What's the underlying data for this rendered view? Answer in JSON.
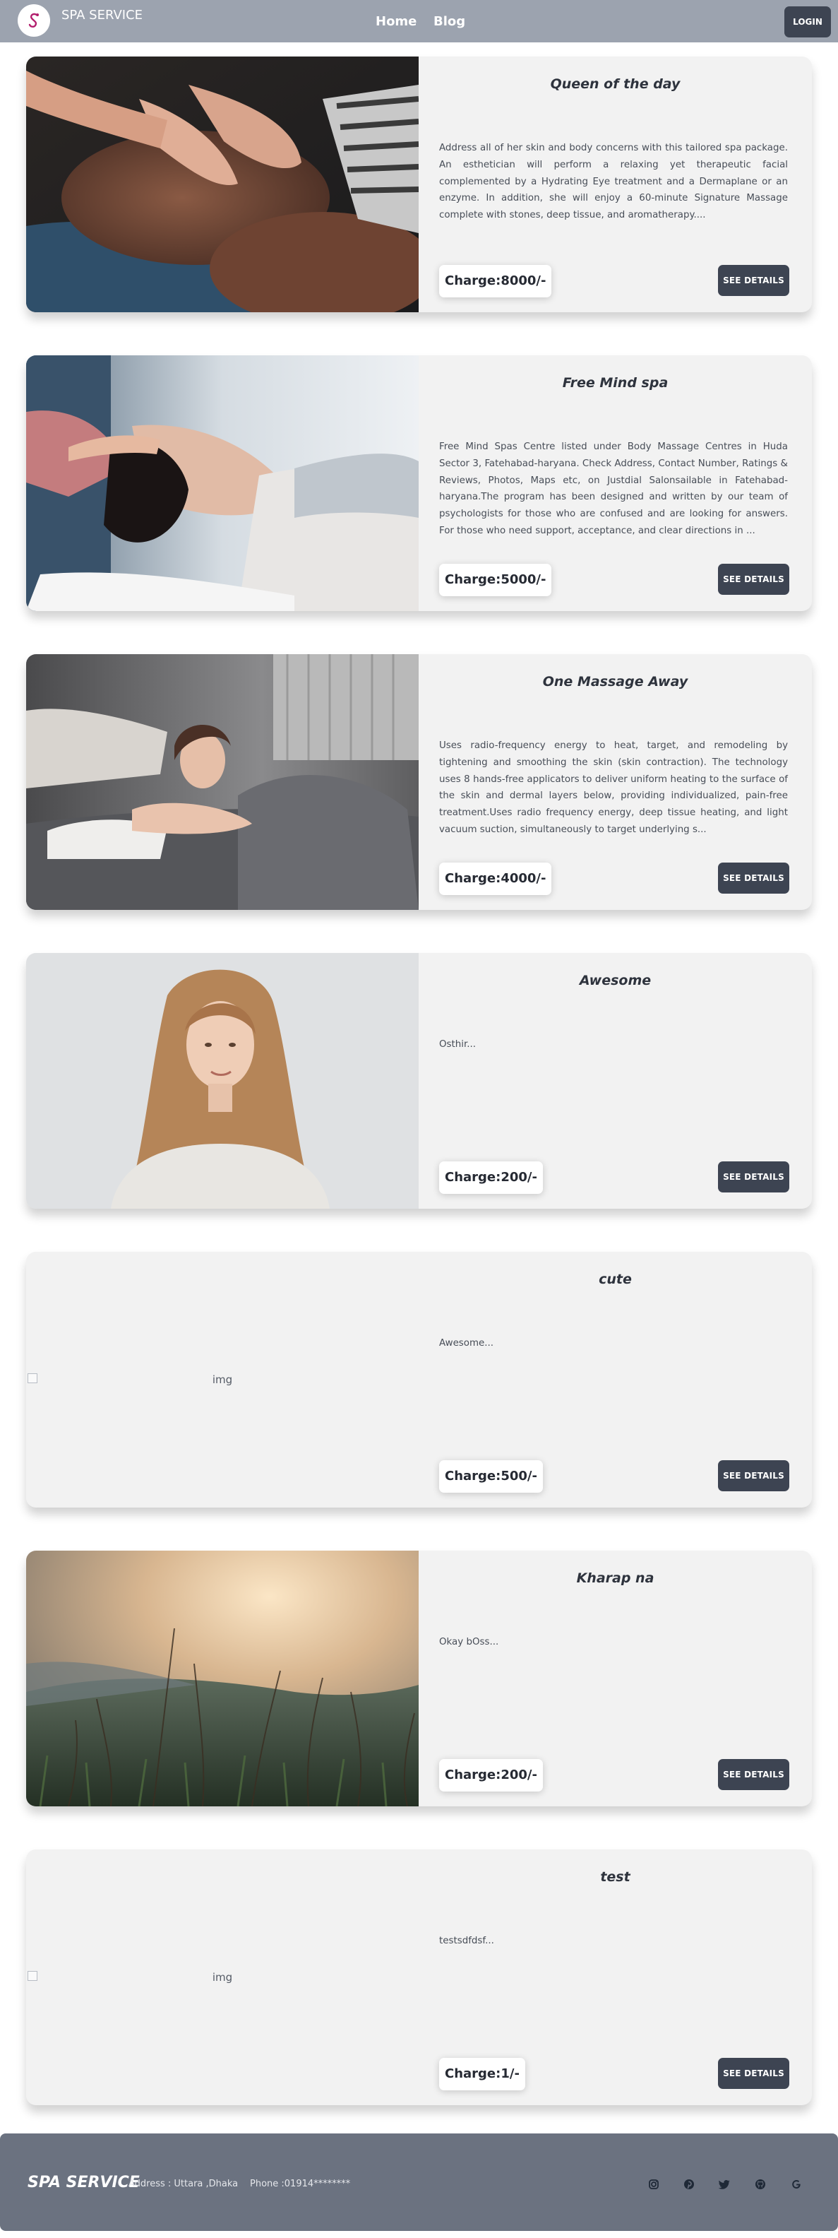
{
  "nav": {
    "brand": "SPA SERVICE",
    "links": [
      "Home",
      "Blog"
    ],
    "login": "LOGIN"
  },
  "services": [
    {
      "title": "Queen of the day",
      "description": "Address all of her skin and body concerns with this tailored spa package. An esthetician will perform a relaxing yet therapeutic facial complemented by a Hydrating Eye treatment and a Dermaplane or an enzyme. In addition, she will enjoy a 60-minute Signature Massage complete with stones, deep tissue, and aromatherapy....",
      "charge": "Charge:8000/-",
      "button": "SEE DETAILS",
      "image": "facial-massage-photo"
    },
    {
      "title": "Free Mind spa",
      "description": "Free Mind Spas Centre listed under Body Massage Centres in Huda Sector 3, Fatehabad-haryana. Check Address, Contact Number, Ratings & Reviews, Photos, Maps etc, on Justdial Salonsailable in Fatehabad-haryana.The program has been designed and written by our team of psychologists for those who are confused and are looking for answers. For those who need support, acceptance, and clear directions in ...",
      "charge": "Charge:5000/-",
      "button": "SEE DETAILS",
      "image": "face-massage-spa-photo"
    },
    {
      "title": "One Massage Away",
      "description": "Uses radio-frequency energy to heat, target, and remodeling by tightening and smoothing the skin (skin contraction). The technology uses 8 hands-free applicators to deliver uniform heating to the surface of the skin and dermal layers below, providing individualized, pain-free treatment.Uses radio frequency energy, deep tissue heating, and light vacuum suction, simultaneously to target underlying s...",
      "charge": "Charge:4000/-",
      "button": "SEE DETAILS",
      "image": "woman-lying-spa-photo"
    },
    {
      "title": "Awesome",
      "description": "Osthir...",
      "charge": "Charge:200/-",
      "button": "SEE DETAILS",
      "image": "woman-portrait-photo"
    },
    {
      "title": "cute",
      "description": "Awesome...",
      "charge": "Charge:500/-",
      "button": "SEE DETAILS",
      "image": "broken",
      "alt": "img"
    },
    {
      "title": "Kharap na",
      "description": "Okay bOss...",
      "charge": "Charge:200/-",
      "button": "SEE DETAILS",
      "image": "grass-field-sunset-photo"
    },
    {
      "title": "test",
      "description": "testsdfdsf...",
      "charge": "Charge:1/-",
      "button": "SEE DETAILS",
      "image": "broken",
      "alt": "img"
    }
  ],
  "footer": {
    "brand": "SPA SERVICE",
    "address": "Address : Uttara ,Dhaka",
    "phone": "Phone :01914********",
    "social": [
      "instagram-icon",
      "pinterest-icon",
      "twitter-icon",
      "github-icon",
      "google-icon"
    ]
  },
  "colors": {
    "navbar": "#9ca3af",
    "button": "#3d4452",
    "card": "#f2f2f2",
    "footer": "#6b7280"
  }
}
